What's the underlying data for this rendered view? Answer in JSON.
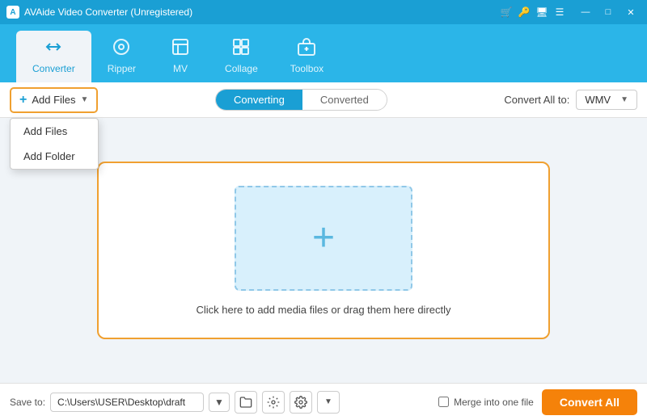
{
  "titleBar": {
    "title": "AVAide Video Converter (Unregistered)",
    "controls": {
      "cart": "🛒",
      "key": "🔑",
      "monitor": "🖥",
      "menu": "☰",
      "minimize": "—",
      "maximize": "□",
      "close": "✕"
    }
  },
  "navTabs": [
    {
      "id": "converter",
      "label": "Converter",
      "icon": "⟳",
      "active": true
    },
    {
      "id": "ripper",
      "label": "Ripper",
      "icon": "◎",
      "active": false
    },
    {
      "id": "mv",
      "label": "MV",
      "icon": "🖼",
      "active": false
    },
    {
      "id": "collage",
      "label": "Collage",
      "icon": "⊞",
      "active": false
    },
    {
      "id": "toolbox",
      "label": "Toolbox",
      "icon": "🧰",
      "active": false
    }
  ],
  "toolbar": {
    "addFilesLabel": "Add Files",
    "dropdownItems": [
      "Add Files",
      "Add Folder"
    ],
    "tabs": [
      "Converting",
      "Converted"
    ],
    "activeTab": "Converting",
    "convertAllToLabel": "Convert All to:",
    "formatValue": "WMV"
  },
  "dropZone": {
    "hintText": "Click here to add media files or drag them here directly"
  },
  "footer": {
    "saveToLabel": "Save to:",
    "savePath": "C:\\Users\\USER\\Desktop\\draft",
    "mergeLabel": "Merge into one file",
    "convertAllLabel": "Convert All"
  }
}
